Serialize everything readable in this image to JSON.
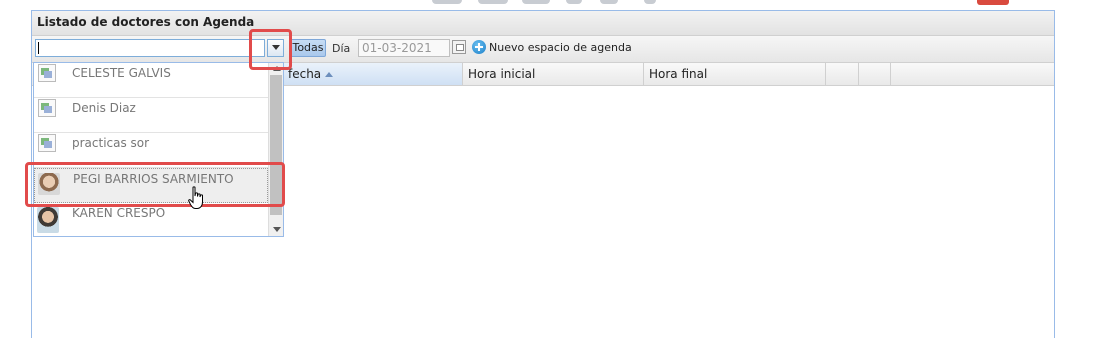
{
  "panel": {
    "title": "Listado de doctores con Agenda"
  },
  "toolbar": {
    "combo_value": "",
    "todas_label": "Todas",
    "dia_label": "Día",
    "date_value": "01-03-2021",
    "nuevo_label": "Nuevo espacio de agenda"
  },
  "grid": {
    "columns": [
      "fecha",
      "Hora inicial",
      "Hora final"
    ],
    "sorted_column": "fecha",
    "sort_direction": "asc"
  },
  "dropdown": {
    "items": [
      {
        "name": "CELESTE GALVIS",
        "image": "broken"
      },
      {
        "name": "Denis Diaz",
        "image": "broken"
      },
      {
        "name": "practicas sor",
        "image": "broken"
      },
      {
        "name": "PEGI BARRIOS SARMIENTO",
        "image": "photo",
        "selected": true
      },
      {
        "name": "KAREN CRESPO",
        "image": "photo"
      }
    ]
  },
  "colors": {
    "highlight": "#e14b4b",
    "panel_border": "#99bbe8",
    "accent": "#1b7fc9"
  },
  "icons": [
    "combo-trigger-icon",
    "calendar-icon",
    "add-icon",
    "hand-cursor-icon"
  ]
}
